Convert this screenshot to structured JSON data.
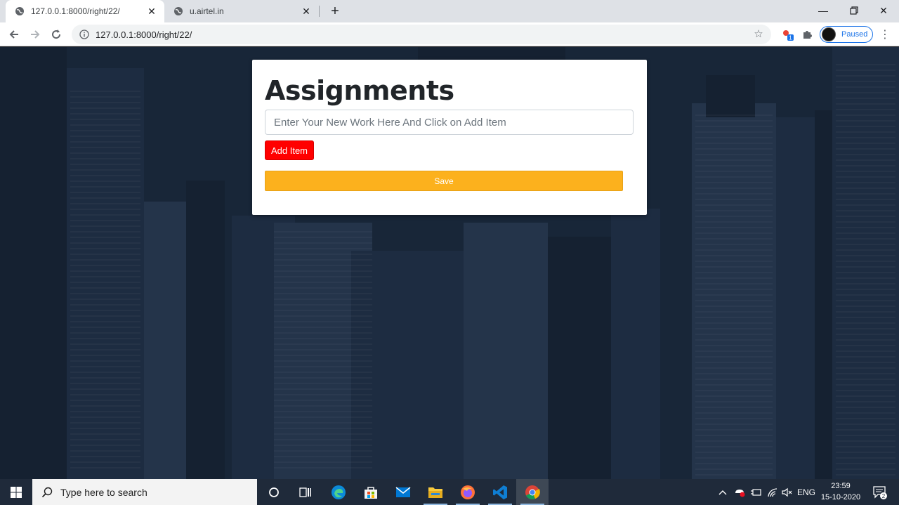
{
  "browser": {
    "tabs": [
      {
        "title": "127.0.0.1:8000/right/22/",
        "active": true
      },
      {
        "title": "u.airtel.in",
        "active": false
      }
    ],
    "address_bar": {
      "url": "127.0.0.1:8000/right/22/"
    },
    "profile": {
      "status": "Paused"
    },
    "extension_badge": "1"
  },
  "app": {
    "heading": "Assignments",
    "new_item_input": {
      "placeholder": "Enter Your New Work Here And Click on Add Item",
      "value": ""
    },
    "add_button_label": "Add Item",
    "save_button_label": "Save",
    "colors": {
      "add_button": "#ff0000",
      "save_button": "#fcb11d",
      "page_background": "#1b2839"
    }
  },
  "taskbar": {
    "search_placeholder": "Type here to search",
    "tray": {
      "language": "ENG",
      "time": "23:59",
      "date": "15-10-2020",
      "notification_count": "2"
    }
  }
}
